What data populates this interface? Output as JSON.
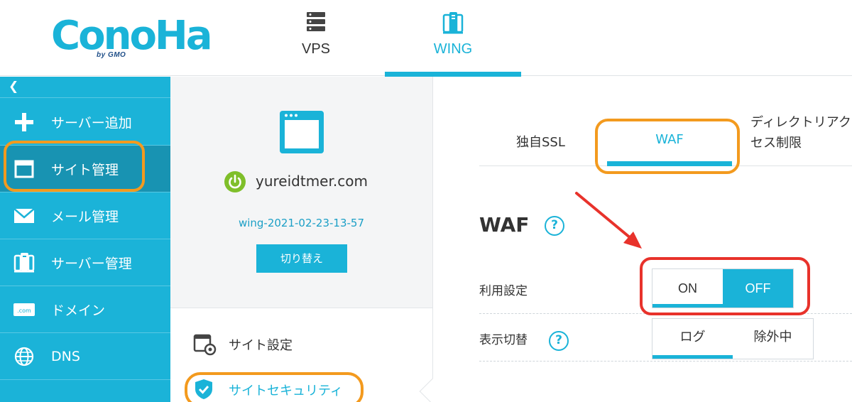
{
  "header": {
    "logo": {
      "text": "ConoHa",
      "sub": "by GMO"
    },
    "tabs": [
      {
        "label": "VPS",
        "icon": "server-rack-icon"
      },
      {
        "label": "WING",
        "icon": "wing-servers-icon",
        "active": true
      }
    ]
  },
  "sidebar": {
    "collapse_glyph": "❮",
    "items": [
      {
        "label": "サーバー追加",
        "icon": "plus-icon"
      },
      {
        "label": "サイト管理",
        "icon": "window-icon",
        "active": true
      },
      {
        "label": "メール管理",
        "icon": "mail-icon"
      },
      {
        "label": "サーバー管理",
        "icon": "server-icon"
      },
      {
        "label": "ドメイン",
        "icon": "domain-icon",
        "icon_text": ".com"
      },
      {
        "label": "DNS",
        "icon": "globe-icon"
      }
    ]
  },
  "site": {
    "domain": "yureidtmer.com",
    "id": "wing-2021-02-23-13-57",
    "switch_label": "切り替え",
    "menu": [
      {
        "label": "サイト設定",
        "icon": "settings-window-icon"
      },
      {
        "label": "サイトセキュリティ",
        "icon": "shield-icon",
        "active": true
      }
    ]
  },
  "content": {
    "tabs": [
      {
        "label": "独自SSL"
      },
      {
        "label": "WAF",
        "active": true
      },
      {
        "label": "ディレクトリアクセス制限"
      }
    ],
    "title": "WAF",
    "help_glyph": "?",
    "use_setting": {
      "label": "利用設定",
      "on": "ON",
      "off": "OFF",
      "selected": "OFF"
    },
    "view_switch": {
      "label": "表示切替",
      "log": "ログ",
      "excluded": "除外中",
      "selected": "ログ"
    }
  },
  "colors": {
    "brand": "#1ab3d8",
    "sidebar_active": "#1893b2",
    "power_green": "#7fbf2a",
    "highlight_orange": "#f39a1e",
    "highlight_red": "#e8322b"
  }
}
